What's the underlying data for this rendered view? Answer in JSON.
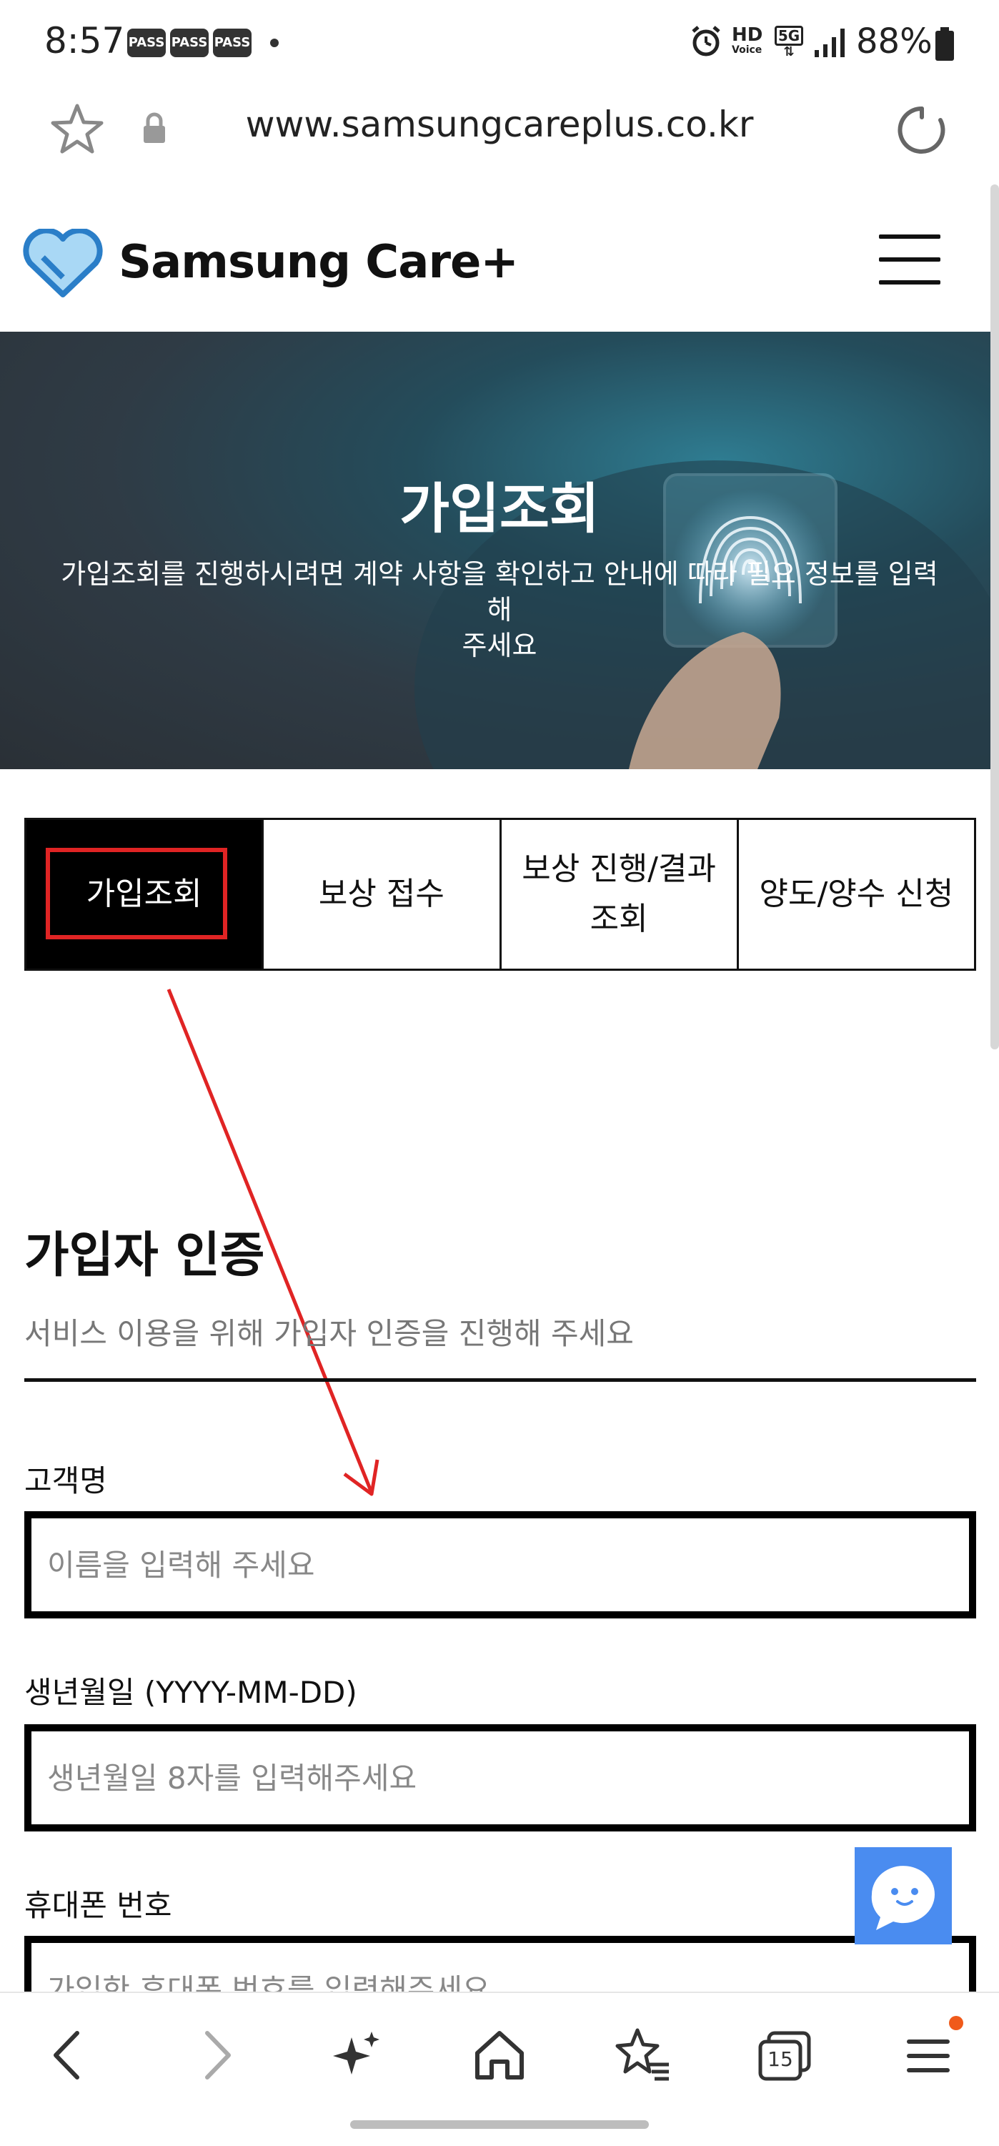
{
  "status_bar": {
    "time": "8:57",
    "badges": [
      "PASS",
      "PASS",
      "PASS"
    ],
    "network": "HD",
    "network_sub": "Voice",
    "signal_type": "5G",
    "battery": "88%"
  },
  "browser": {
    "url": "www.samsungcareplus.co.kr"
  },
  "site": {
    "brand": "Samsung Care+"
  },
  "hero": {
    "title": "가입조회",
    "subtitle_line1": "가입조회를 진행하시려면 계약 사항을 확인하고 안내에 따라 필요 정보를 입력해",
    "subtitle_line2": "주세요"
  },
  "tabs": [
    {
      "label_line1": "가입조회",
      "label_line2": ""
    },
    {
      "label_line1": "보상 접수",
      "label_line2": ""
    },
    {
      "label_line1": "보상 진행/결과",
      "label_line2": "조회"
    },
    {
      "label_line1": "양도/양수 신청",
      "label_line2": ""
    }
  ],
  "form": {
    "title": "가입자 인증",
    "subtitle": "서비스 이용을 위해 가입자 인증을 진행해 주세요",
    "fields": [
      {
        "label": "고객명",
        "value": "",
        "placeholder": "이름을 입력해 주세요"
      },
      {
        "label": "생년월일 (YYYY-MM-DD)",
        "value": "",
        "placeholder": "생년월일 8자를 입력해주세요"
      },
      {
        "label": "휴대폰 번호",
        "value": "",
        "placeholder": "가입한 휴대폰 번호를 입력해주세요"
      }
    ]
  },
  "bottom_nav": {
    "tab_count": "15"
  },
  "colors": {
    "annotation_red": "#e02424",
    "chat_blue": "#4a8cf0",
    "active_tab_bg": "#000000"
  }
}
